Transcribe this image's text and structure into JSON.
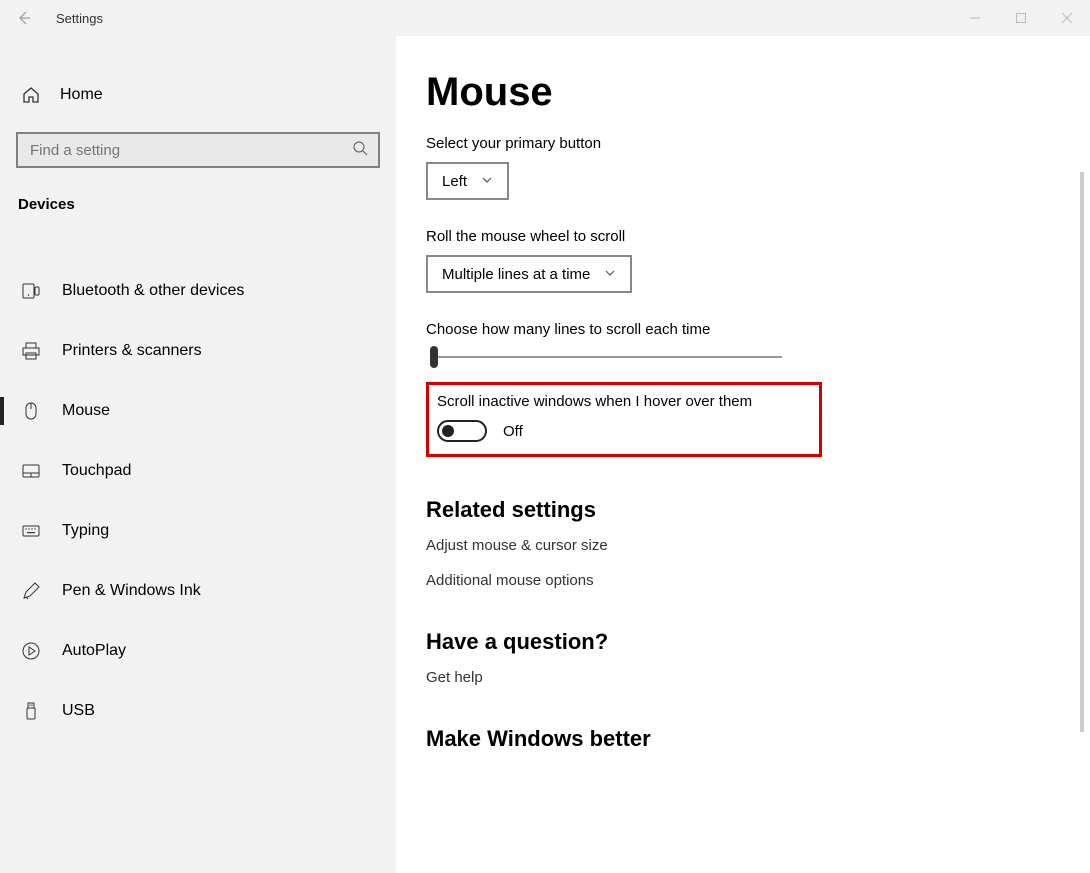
{
  "titlebar": {
    "app_name": "Settings"
  },
  "sidebar": {
    "home_label": "Home",
    "search_placeholder": "Find a setting",
    "section": "Devices",
    "items": [
      {
        "label": "Bluetooth & other devices",
        "icon": "bluetooth-devices-icon",
        "selected": false
      },
      {
        "label": "Printers & scanners",
        "icon": "printer-icon",
        "selected": false
      },
      {
        "label": "Mouse",
        "icon": "mouse-icon",
        "selected": true
      },
      {
        "label": "Touchpad",
        "icon": "touchpad-icon",
        "selected": false
      },
      {
        "label": "Typing",
        "icon": "keyboard-icon",
        "selected": false
      },
      {
        "label": "Pen & Windows Ink",
        "icon": "pen-icon",
        "selected": false
      },
      {
        "label": "AutoPlay",
        "icon": "autoplay-icon",
        "selected": false
      },
      {
        "label": "USB",
        "icon": "usb-icon",
        "selected": false
      }
    ]
  },
  "content": {
    "title": "Mouse",
    "primary_button_label": "Select your primary button",
    "primary_button_value": "Left",
    "roll_wheel_label": "Roll the mouse wheel to scroll",
    "roll_wheel_value": "Multiple lines at a time",
    "lines_label": "Choose how many lines to scroll each time",
    "scroll_inactive_label": "Scroll inactive windows when I hover over them",
    "scroll_inactive_value": "Off",
    "related_heading": "Related settings",
    "related_links": [
      "Adjust mouse & cursor size",
      "Additional mouse options"
    ],
    "question_heading": "Have a question?",
    "get_help_label": "Get help",
    "improve_heading": "Make Windows better"
  }
}
